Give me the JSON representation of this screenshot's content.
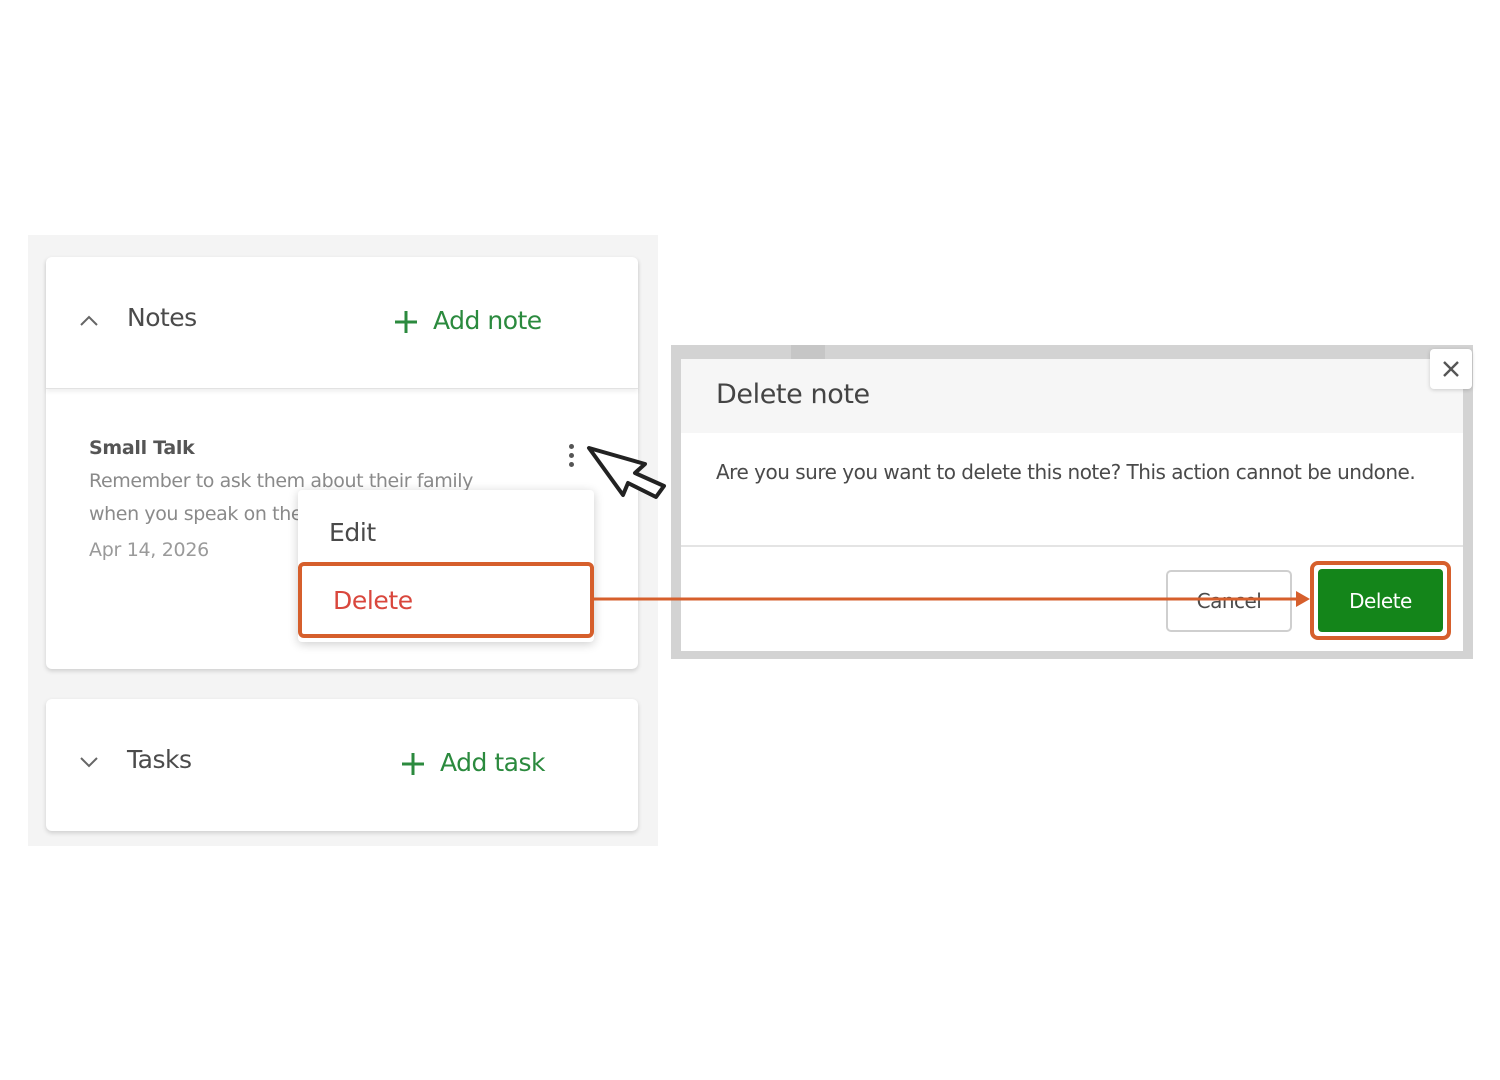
{
  "notes_section": {
    "title": "Notes",
    "add_label": "Add note",
    "expanded": true,
    "note": {
      "title": "Small Talk",
      "body": "Remember to ask them about their family when you speak on the phone.",
      "date": "Apr 14, 2026"
    }
  },
  "context_menu": {
    "items": [
      {
        "label": "Edit"
      },
      {
        "label": "Delete"
      }
    ]
  },
  "tasks_section": {
    "title": "Tasks",
    "add_label": "Add task",
    "expanded": false
  },
  "dialog": {
    "title": "Delete note",
    "message": "Are you sure you want to delete this note? This action cannot be undone.",
    "cancel_label": "Cancel",
    "confirm_label": "Delete"
  },
  "colors": {
    "accent_green": "#2b8a3e",
    "button_green": "#14851a",
    "danger_red": "#d9473d",
    "highlight_orange": "#d65f2c"
  },
  "icons": [
    "chevron-up-icon",
    "plus-icon",
    "more-vertical-icon",
    "cursor-pointer-icon",
    "close-icon",
    "chevron-down-icon"
  ]
}
